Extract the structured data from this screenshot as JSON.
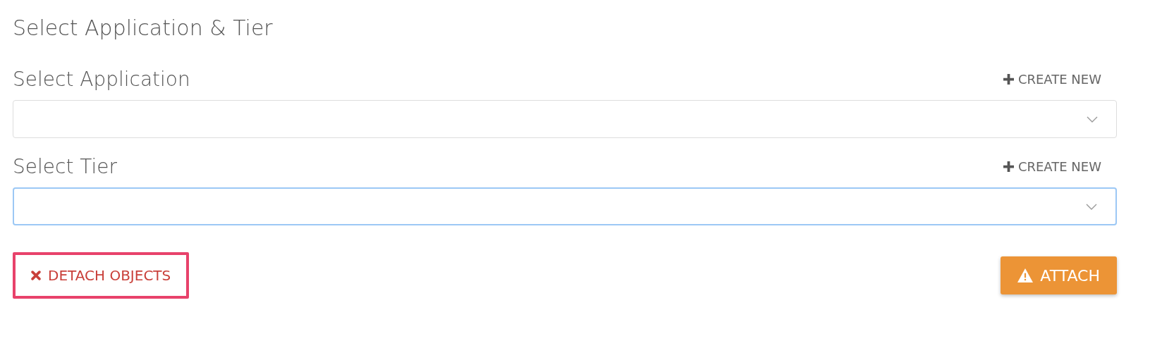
{
  "title": "Select Application & Tier",
  "fields": [
    {
      "label": "Select Application",
      "action": "CREATE NEW",
      "focused": false
    },
    {
      "label": "Select Tier",
      "action": "CREATE NEW",
      "focused": true
    }
  ],
  "buttons": {
    "detach": "DETACH OBJECTS",
    "attach": "ATTACH"
  }
}
